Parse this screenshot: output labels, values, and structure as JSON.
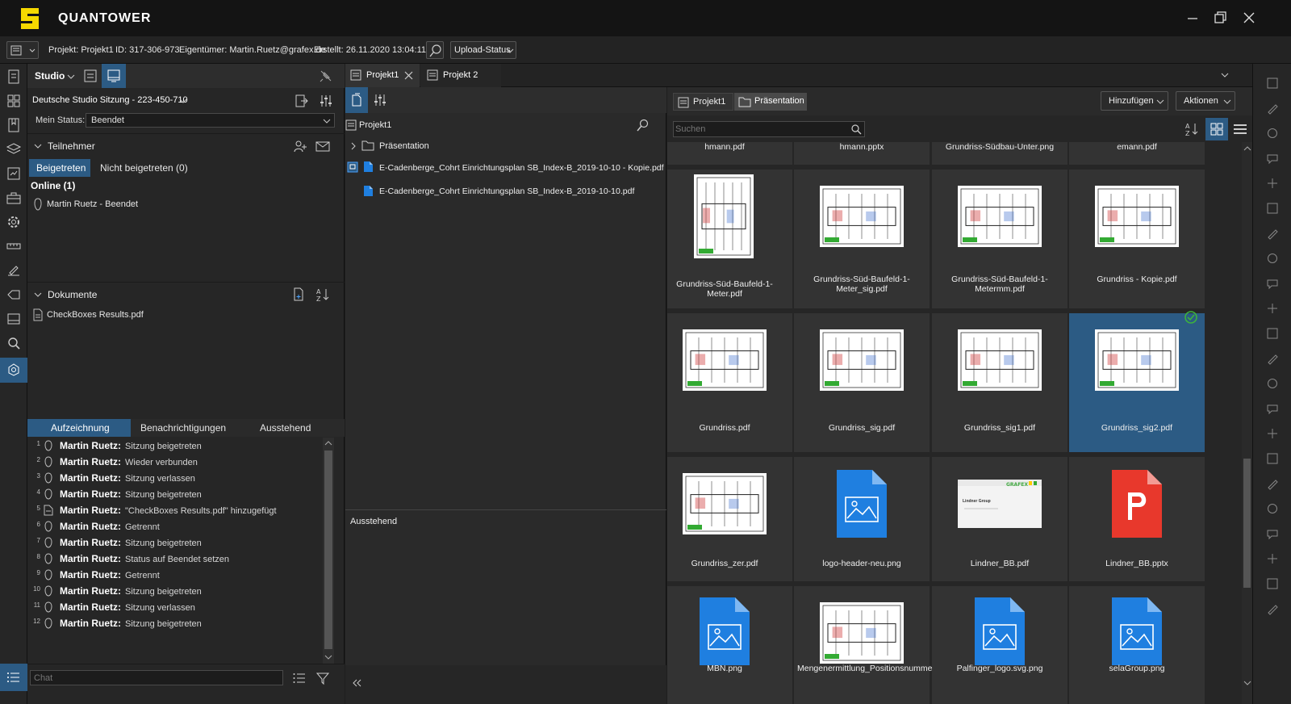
{
  "app": {
    "title": "QUANTOWER"
  },
  "infobar": {
    "project": "Projekt: Projekt1",
    "id": "ID: 317-306-973",
    "owner": "Eigentümer: Martin.Ruetz@grafex.de",
    "created": "Erstellt: 26.11.2020 13:04:11",
    "upload_status": "Upload-Status"
  },
  "studio": {
    "title": "Studio",
    "session": "Deutsche Studio Sitzung - 223-450-710",
    "status_label": "Mein Status:",
    "status_value": "Beendet",
    "participants": {
      "title": "Teilnehmer",
      "tab_joined": "Beigetreten",
      "tab_not_joined": "Nicht beigetreten (0)",
      "online_header": "Online (1)",
      "members": [
        "Martin Ruetz - Beendet"
      ]
    },
    "documents": {
      "title": "Dokumente",
      "items": [
        "CheckBoxes Results.pdf"
      ]
    },
    "log": {
      "tabs": [
        "Aufzeichnung",
        "Benachrichtigungen",
        "Ausstehend"
      ],
      "entries": [
        {
          "n": "1",
          "user": "Martin Ruetz:",
          "msg": "Sitzung beigetreten"
        },
        {
          "n": "2",
          "user": "Martin Ruetz:",
          "msg": "Wieder verbunden"
        },
        {
          "n": "3",
          "user": "Martin Ruetz:",
          "msg": "Sitzung verlassen"
        },
        {
          "n": "4",
          "user": "Martin Ruetz:",
          "msg": "Sitzung beigetreten"
        },
        {
          "n": "5",
          "user": "Martin Ruetz:",
          "msg": "\"CheckBoxes Results.pdf\" hinzugefügt"
        },
        {
          "n": "6",
          "user": "Martin Ruetz:",
          "msg": "Getrennt"
        },
        {
          "n": "7",
          "user": "Martin Ruetz:",
          "msg": "Sitzung beigetreten"
        },
        {
          "n": "8",
          "user": "Martin Ruetz:",
          "msg": "Status auf Beendet setzen"
        },
        {
          "n": "9",
          "user": "Martin Ruetz:",
          "msg": "Getrennt"
        },
        {
          "n": "10",
          "user": "Martin Ruetz:",
          "msg": "Sitzung beigetreten"
        },
        {
          "n": "11",
          "user": "Martin Ruetz:",
          "msg": "Sitzung verlassen"
        },
        {
          "n": "12",
          "user": "Martin Ruetz:",
          "msg": "Sitzung beigetreten"
        }
      ]
    },
    "chat_placeholder": "Chat"
  },
  "tabs": [
    "Projekt1",
    "Projekt 2"
  ],
  "tree": {
    "root": "Projekt1",
    "folder": "Präsentation",
    "files": [
      "E-Cadenberge_Cohrt Einrichtungsplan SB_Index-B_2019-10-10 - Kopie.pdf",
      "E-Cadenberge_Cohrt Einrichtungsplan SB_Index-B_2019-10-10.pdf"
    ],
    "pending_header": "Ausstehend"
  },
  "browser": {
    "breadcrumb": [
      "Projekt1",
      "Präsentation"
    ],
    "add_button": "Hinzufügen",
    "actions_button": "Aktionen",
    "search_placeholder": "Suchen",
    "partial_row": [
      "hmann.pdf",
      "hmann.pptx",
      "Grundriss-Südbau-Unter.png",
      "emann.pdf"
    ],
    "items": [
      {
        "label": "Grundriss-Süd-Baufeld-1-Meter.pdf",
        "kind": "plan-tall"
      },
      {
        "label": "Grundriss-Süd-Baufeld-1-Meter_sig.pdf",
        "kind": "plan"
      },
      {
        "label": "Grundriss-Süd-Baufeld-1-Metermm.pdf",
        "kind": "plan"
      },
      {
        "label": "Grundriss - Kopie.pdf",
        "kind": "plan"
      },
      {
        "label": "Grundriss.pdf",
        "kind": "plan"
      },
      {
        "label": "Grundriss_sig.pdf",
        "kind": "plan"
      },
      {
        "label": "Grundriss_sig1.pdf",
        "kind": "plan"
      },
      {
        "label": "Grundriss_sig2.pdf",
        "kind": "plan",
        "selected": true
      },
      {
        "label": "Grundriss_zer.pdf",
        "kind": "plan"
      },
      {
        "label": "logo-header-neu.png",
        "kind": "image"
      },
      {
        "label": "Lindner_BB.pdf",
        "kind": "doc"
      },
      {
        "label": "Lindner_BB.pptx",
        "kind": "pptx"
      },
      {
        "label": "MBN.png",
        "kind": "image"
      },
      {
        "label": "Mengenermittlung_Positionsnummer.pdf",
        "kind": "plan"
      },
      {
        "label": "Palfinger_logo.svg.png",
        "kind": "image"
      },
      {
        "label": "selaGroup.png",
        "kind": "image"
      }
    ],
    "doc_thumb_text": "Lindner Group"
  },
  "colors": {
    "accent": "#2c5b84",
    "logo": "#f5d800",
    "file_blue": "#1f7fe0",
    "pptx_red": "#e8382c"
  }
}
